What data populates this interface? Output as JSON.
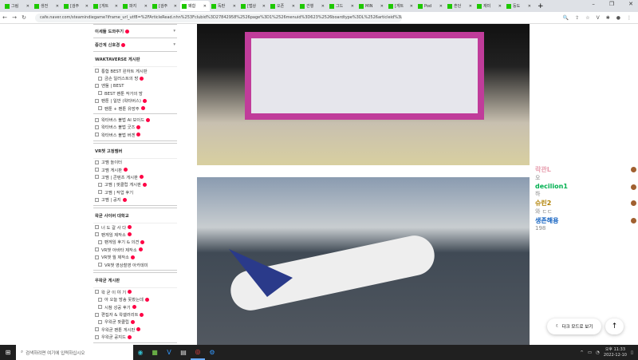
{
  "browser": {
    "tabs": [
      "그림",
      "생전",
      "[검주",
      "[게트",
      "파지",
      "[검주",
      "왜합",
      "독판",
      "[맵상",
      "오픈",
      "건행",
      "그드",
      "MIN",
      "[게트",
      "Pod",
      "혼던",
      "재미",
      "둥도"
    ],
    "active_tab": 6,
    "new_tab": "+",
    "url": "cafe.naver.com/steamindiegame?iframe_url_utf8=%2FArticleRead.nhn%253Fclubid%3D27842958%2526page%3D1%2526menuid%3D623%2526boardtype%3DL%2526articleid%3D8824964%2526referrerAllArticles%3D..."
  },
  "sidebar": {
    "top_buttons": [
      "이세돌 도와주기",
      "중간계 신호경"
    ],
    "sections": [
      {
        "title": "WAKTAVERSE 게시판",
        "groups": [
          [
            {
              "l": "통합 BEST 왼하트 게시판",
              "s": 0,
              "n": 0
            },
            {
              "l": "금손 일러스트의 방",
              "s": 1,
              "n": 1
            },
            {
              "l": "엔둘 | BEST",
              "s": 0,
              "n": 0
            },
            {
              "l": "BEST 팬툰 작가의 방",
              "s": 1,
              "n": 0
            },
            {
              "l": "팬툰 | 일반 (왁타버스)",
              "s": 0,
              "n": 1
            },
            {
              "l": "팬툰 + 팬툰 유망주",
              "s": 1,
              "n": 1
            }
          ],
          [
            {
              "l": "왁타버스 불법 AI 보이드",
              "s": 0,
              "n": 1
            },
            {
              "l": "왁타버스 불법 굿즈",
              "s": 0,
              "n": 1
            },
            {
              "l": "왁타버스 불법 버겐",
              "s": 0,
              "n": 1
            }
          ]
        ]
      },
      {
        "title": "VR챗 고정멤버",
        "groups": [
          [
            {
              "l": "고멤 놀이터",
              "s": 0,
              "n": 0
            },
            {
              "l": "고멤 게시판",
              "s": 0,
              "n": 1
            },
            {
              "l": "고멤 | 콘텐츠 게시판",
              "s": 0,
              "n": 1
            },
            {
              "l": "고멤 | 팟클럽 게시판",
              "s": 1,
              "n": 1
            },
            {
              "l": "고멤 | 작업 후기",
              "s": 1,
              "n": 0
            },
            {
              "l": "고멤 | 공지",
              "s": 0,
              "n": 1
            }
          ]
        ]
      },
      {
        "title": "왁굳 사이버 대학교",
        "groups": [
          [
            {
              "l": "너 도 갈 사 다",
              "s": 0,
              "n": 1
            },
            {
              "l": "팬게임 제작소",
              "s": 0,
              "n": 1
            },
            {
              "l": "팬게임 후기 & 의견",
              "s": 1,
              "n": 1
            },
            {
              "l": "VR챗 아바타 제작소",
              "s": 0,
              "n": 1
            },
            {
              "l": "VR챗 월 제작소",
              "s": 0,
              "n": 1
            },
            {
              "l": "VR챗 영상촬영 아카데미",
              "s": 1,
              "n": 0
            }
          ]
        ]
      },
      {
        "title": "우왁굳 게시판",
        "groups": [
          [
            {
              "l": "왁 굳 이 야 기",
              "s": 0,
              "n": 1
            },
            {
              "l": "아 오늘 방송 못봤는데",
              "s": 1,
              "n": 1
            },
            {
              "l": "시참 성공 후기",
              "s": 1,
              "n": 1
            },
            {
              "l": "편집자 & 왁갤러리트",
              "s": 0,
              "n": 1
            },
            {
              "l": "우왁굳 팟클립",
              "s": 1,
              "n": 1
            },
            {
              "l": "우왁굳 팬툰 게시판",
              "s": 0,
              "n": 1
            },
            {
              "l": "우왁굳 공지드",
              "s": 0,
              "n": 1
            }
          ]
        ]
      }
    ]
  },
  "chat": [
    {
      "nick": "락관L",
      "msg": "오",
      "color": "#e8a0b0"
    },
    {
      "nick": "decilion1",
      "msg": "하",
      "color": "#00b050"
    },
    {
      "nick": "슈린2",
      "msg": "와 ㄷㄷ",
      "color": "#b08000"
    },
    {
      "nick": "생존해용",
      "msg": "198",
      "color": "#1060c0"
    }
  ],
  "buttons": {
    "dark_mode": "다크 모드로 보기",
    "scroll_top": "↑"
  },
  "taskbar": {
    "search_placeholder": "검색하려면 여기에 입력하십시오",
    "time": "오후 11:33",
    "date": "2022-12-10"
  }
}
